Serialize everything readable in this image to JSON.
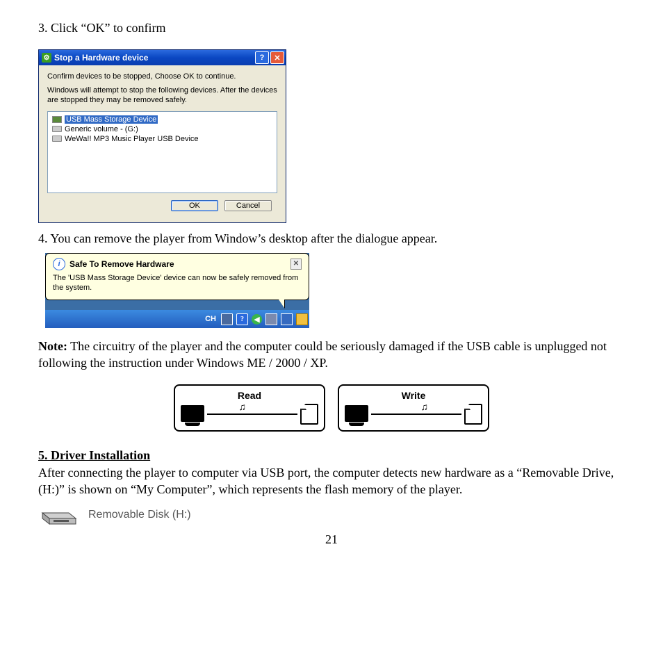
{
  "step3": "3. Click “OK” to confirm",
  "dialog1": {
    "title": "Stop a Hardware device",
    "instr1": "Confirm devices to be stopped, Choose OK to continue.",
    "instr2": "Windows will attempt to stop the following devices. After the devices are stopped they may be removed safely.",
    "items": [
      "USB Mass Storage Device",
      "Generic volume - (G:)",
      "WeWa!! MP3 Music Player USB Device"
    ],
    "ok": "OK",
    "cancel": "Cancel"
  },
  "step4": "4. You can remove the player from Window’s desktop after the dialogue appear.",
  "balloon": {
    "title": "Safe To Remove Hardware",
    "body": "The 'USB Mass Storage Device' device can now be safely removed from the system.",
    "tray_ch": "CH"
  },
  "note_label": "Note:",
  "note_body": "  The circuitry of the player and the computer could be seriously damaged if the USB cable is unplugged not following the instruction under Windows ME / 2000 / XP.",
  "rw": {
    "read": "Read",
    "write": "Write"
  },
  "section5": {
    "heading": "5.  Driver Installation",
    "body": "After connecting the player to computer via USB port, the computer detects new hardware as a “Removable Drive, (H:)” is shown on “My Computer”, which represents the flash memory of the player.",
    "disk_label": "Removable Disk (H:)"
  },
  "page_number": "21"
}
